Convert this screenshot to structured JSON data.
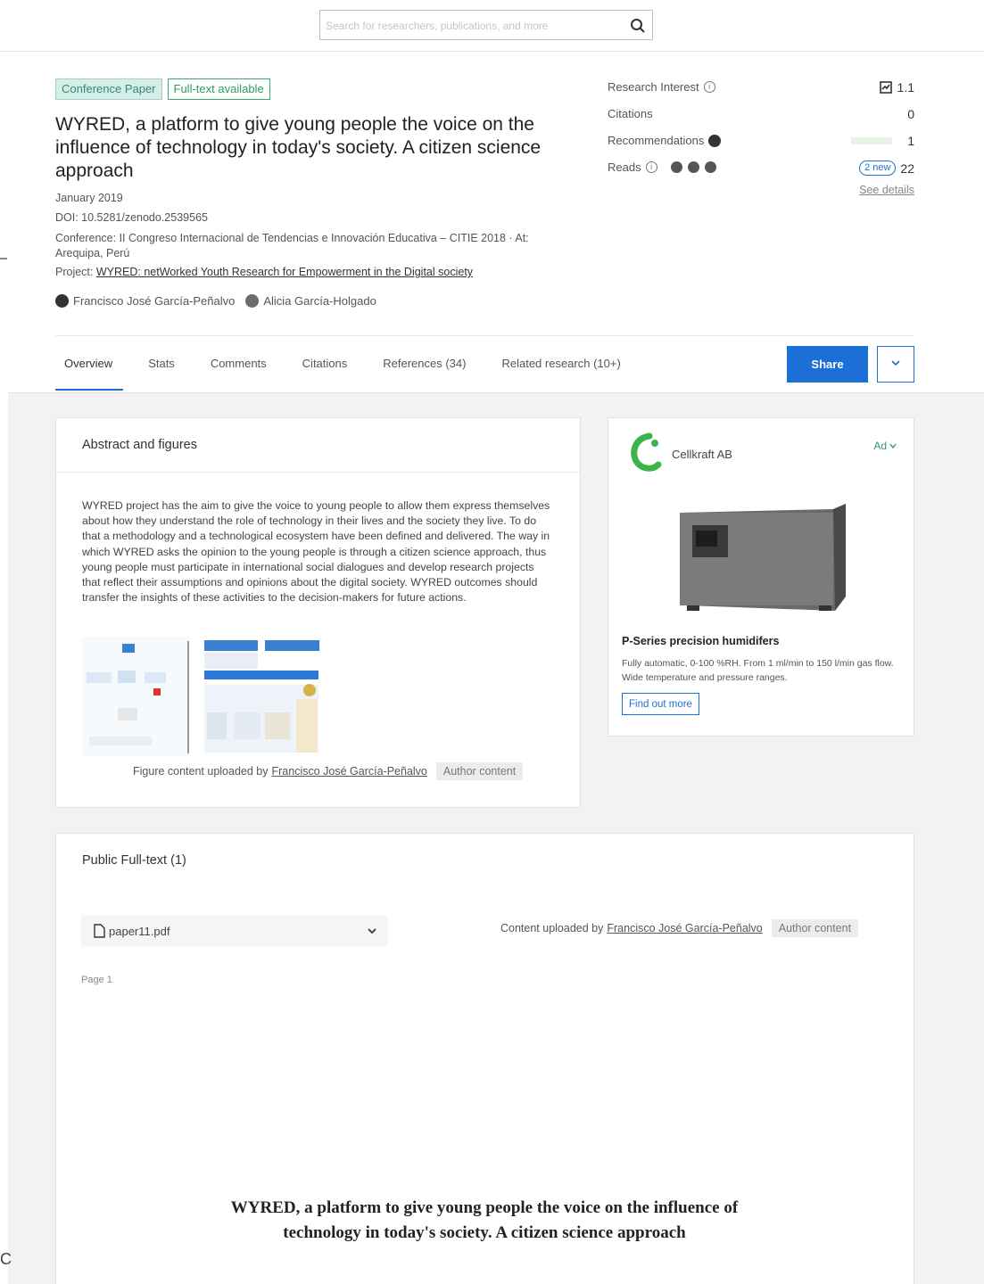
{
  "search": {
    "placeholder": "Search for researchers, publications, and more"
  },
  "publication": {
    "badges": {
      "type": "Conference Paper",
      "fulltext": "Full-text available"
    },
    "title": "WYRED, a platform to give young people the voice on the influence of technology in today's society. A citizen science approach",
    "date": "January 2019",
    "doi": "DOI: 10.5281/zenodo.2539565",
    "conference": "Conference: II Congreso Internacional de Tendencias e Innovación Educativa – CITIE 2018 · At: Arequipa, Perú",
    "project_prefix": "Project: ",
    "project_link": "WYRED: netWorked Youth Research for Empowerment in the Digital society",
    "authors": [
      "Francisco José García-Peñalvo",
      "Alicia García-Holgado"
    ]
  },
  "stats": {
    "research_interest_label": "Research Interest",
    "research_interest_value": "1.1",
    "citations_label": "Citations",
    "citations_value": "0",
    "recommendations_label": "Recommendations",
    "recommendations_value": "1",
    "reads_label": "Reads",
    "reads_new": "2 new",
    "reads_value": "22",
    "see_details": "See details"
  },
  "tabs": [
    "Overview",
    "Stats",
    "Comments",
    "Citations",
    "References (34)",
    "Related research (10+)"
  ],
  "actions": {
    "share": "Share"
  },
  "abstract": {
    "title": "Abstract and figures",
    "text": "WYRED project has the aim to give the voice to young people to allow them express themselves about how they understand the role of technology in their lives and the society they live. To do that a methodology and a technological ecosystem have been defined and delivered. The way in which WYRED asks the opinion to the young people is through a citizen science approach, thus young people must participate in international social dialogues and develop research projects that reflect their assumptions and opinions about the digital society. WYRED outcomes should transfer the insights of these activities to the decision-makers for future actions.",
    "figure_caption_prefix": "Figure content uploaded by",
    "figure_uploader": "Francisco José García-Peñalvo",
    "author_content": "Author content"
  },
  "ad": {
    "brand": "Cellkraft AB",
    "label": "Ad",
    "title": "P-Series precision humidifers",
    "description": "Fully automatic, 0-100 %RH. From 1 ml/min to 150 l/min gas flow. Wide temperature and pressure ranges.",
    "button": "Find out more"
  },
  "fulltext": {
    "title": "Public Full-text (1)",
    "file_name": "paper11.pdf",
    "uploaded_prefix": "Content uploaded by",
    "uploader": "Francisco José García-Peñalvo",
    "author_content": "Author content",
    "page_label": "Page 1",
    "pdf_title": "WYRED, a platform to give young people the voice on the influence of technology in today's society. A citizen science approach"
  },
  "edge_letter": "C",
  "colors": {
    "accent": "#1b6fd6",
    "badge_green": "#2f9a62",
    "badge_teal_bg": "#d7eee8"
  }
}
